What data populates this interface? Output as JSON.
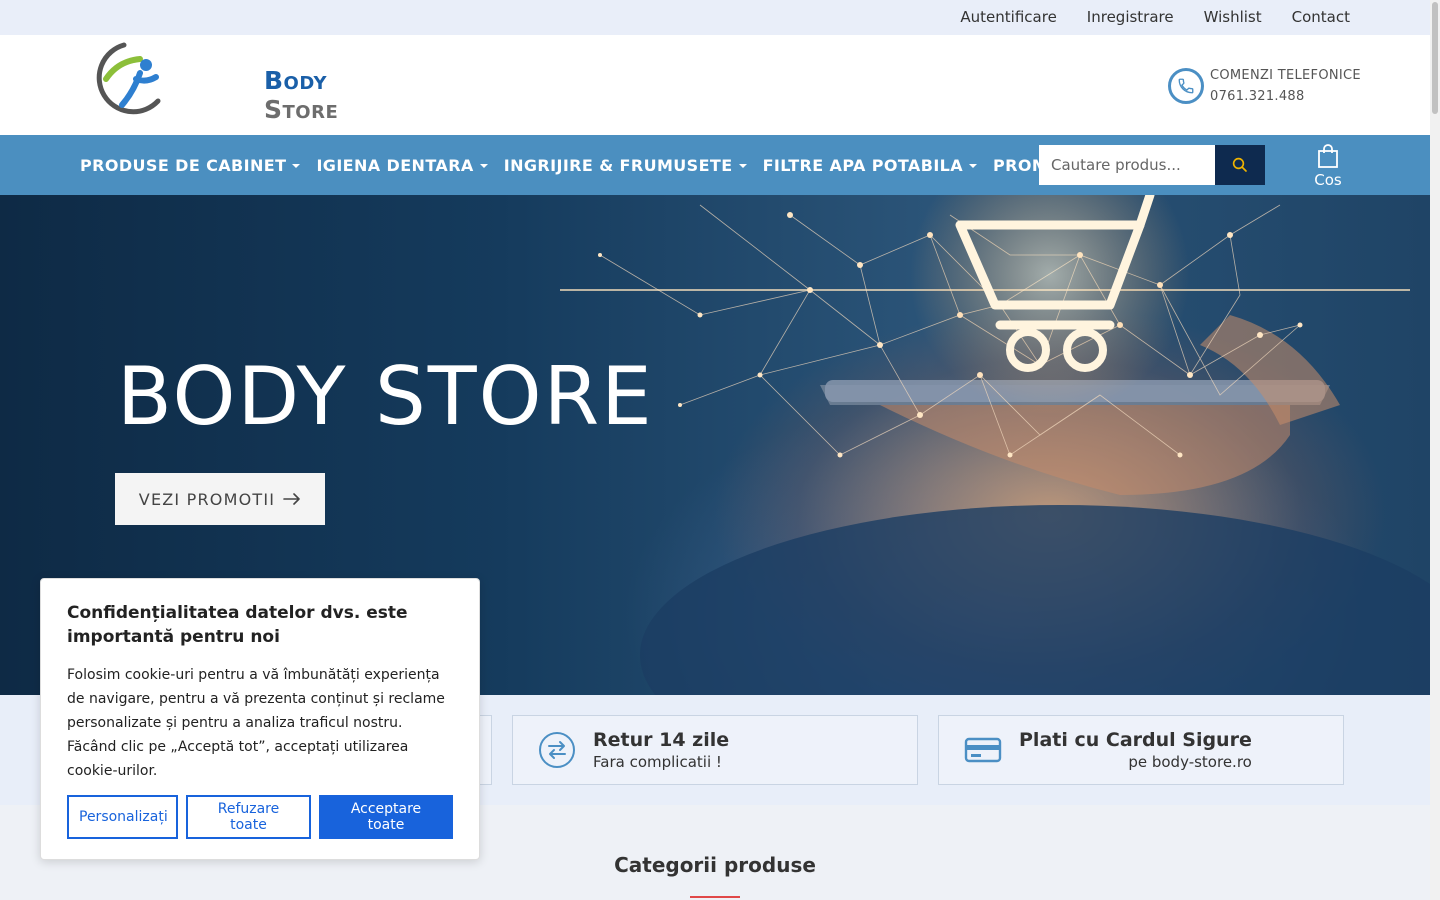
{
  "topbar": {
    "links": [
      "Autentificare",
      "Inregistrare",
      "Wishlist",
      "Contact"
    ]
  },
  "header": {
    "logo_word1": "Body",
    "logo_word2": "Store",
    "phone_label": "COMENZI TELEFONICE",
    "phone_number": "0761.321.488"
  },
  "nav": {
    "items": [
      {
        "label": "PRODUSE DE CABINET",
        "dropdown": true
      },
      {
        "label": "IGIENA DENTARA",
        "dropdown": true
      },
      {
        "label": "INGRIJIRE & FRUMUSETE",
        "dropdown": true
      },
      {
        "label": "FILTRE APA POTABILA",
        "dropdown": true
      },
      {
        "label": "PROMOTII",
        "dropdown": false
      }
    ],
    "search_placeholder": "Cautare produs...",
    "cart_label": "Cos"
  },
  "hero": {
    "title": "BODY STORE",
    "button_label": "VEZI PROMOTII"
  },
  "features": [
    {
      "title": "Retur 14 zile",
      "subtitle": "Fara complicatii !",
      "icon": "exchange-icon"
    },
    {
      "title": "Plati cu Cardul Sigure",
      "subtitle": "pe body-store.ro",
      "icon": "credit-card-icon"
    }
  ],
  "categories": {
    "title": "Categorii produse"
  },
  "cookie": {
    "title": "Confidențialitatea datelor dvs. este importantă pentru noi",
    "text": "Folosim cookie-uri pentru a vă îmbunătăți experiența de navigare, pentru a vă prezenta conținut și reclame personalizate și pentru a analiza traficul nostru. Făcând clic pe „Acceptă tot”, acceptați utilizarea cookie-urilor.",
    "btn_customize": "Personalizați",
    "btn_reject": "Refuzare toate",
    "btn_accept": "Acceptare toate"
  },
  "colors": {
    "nav_bg": "#4b8fc0",
    "search_btn": "#0e2a4f",
    "accent_blue": "#1863dc",
    "category_underline": "#e04848"
  }
}
